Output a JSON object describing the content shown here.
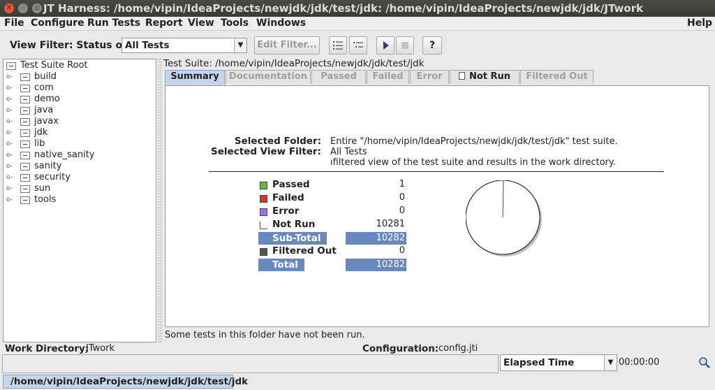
{
  "window": {
    "title": "JT Harness: /home/vipin/IdeaProjects/newjdk/jdk/test/jdk: /home/vipin/IdeaProjects/newjdk/jdk/JTwork",
    "close_glyph": "✕",
    "minimize_glyph": "–",
    "maximize_glyph": "▫"
  },
  "menubar": {
    "file": "File",
    "configure": "Configure",
    "run_tests": "Run Tests",
    "report": "Report",
    "view": "View",
    "tools": "Tools",
    "windows": "Windows",
    "help": "Help"
  },
  "toolbar": {
    "view_filter_label": "View Filter: Status of",
    "view_filter_value": "All Tests",
    "edit_filter": "Edit Filter...",
    "help_button": "?"
  },
  "tree": {
    "root": "Test Suite Root",
    "items": [
      "build",
      "com",
      "demo",
      "java",
      "javax",
      "jdk",
      "lib",
      "native_sanity",
      "sanity",
      "security",
      "sun",
      "tools"
    ]
  },
  "main": {
    "suite_path": "Test Suite: /home/vipin/IdeaProjects/newjdk/jdk/test/jdk",
    "tabs": [
      "Summary",
      "Documentation",
      "Passed",
      "Failed",
      "Error",
      "Not Run",
      "Filtered Out"
    ],
    "selected_folder_label": "Selected Folder:",
    "selected_folder_value": "Entire \"/home/vipin/IdeaProjects/newjdk/jdk/test/jdk\" test suite.",
    "view_filter_label": "Selected View Filter:",
    "view_filter_value": "All Tests",
    "view_filter_desc": "ıfiltered view of the test suite and results in the work directory.",
    "stats": {
      "passed_label": "Passed",
      "passed": "1",
      "failed_label": "Failed",
      "failed": "0",
      "error_label": "Error",
      "error": "0",
      "not_run_label": "Not Run",
      "not_run": "10281",
      "subtotal_label": "Sub-Total",
      "subtotal": "10282",
      "filtered_label": "Filtered Out",
      "filtered": "0",
      "total_label": "Total",
      "total": "10282"
    },
    "status_message": "Some tests in this folder have not been run."
  },
  "chart_data": {
    "type": "pie",
    "categories": [
      "Passed",
      "Failed",
      "Error",
      "Not Run"
    ],
    "values": [
      1,
      0,
      0,
      10281
    ],
    "colors": [
      "#5fbf3f",
      "#e03030",
      "#9f6fff",
      "#ffffff"
    ]
  },
  "bottom": {
    "work_dir_label": "Work Directory:",
    "work_dir_value": "JTwork",
    "config_label": "Configuration:",
    "config_value": "config.jti",
    "elapsed_label": "Elapsed Time",
    "elapsed_value": "00:00:00",
    "path_tab": "/home/vipin/IdeaProjects/newjdk/jdk/test/jdk"
  },
  "colors": {
    "passed": "#5fbf3f",
    "failed": "#e03030",
    "error": "#9f6fff",
    "not_run": "#ffffff",
    "filtered_out": "#555555",
    "total_band": "#6789c0",
    "tab_active": "#c6d6ea"
  },
  "icons": [
    "close-icon",
    "minimize-icon",
    "maximize-icon",
    "dropdown-arrow-icon",
    "list-view-icon",
    "tree-view-icon",
    "run-icon",
    "stop-icon",
    "folder-icon",
    "expander-icon",
    "document-icon",
    "magnifier-icon"
  ]
}
